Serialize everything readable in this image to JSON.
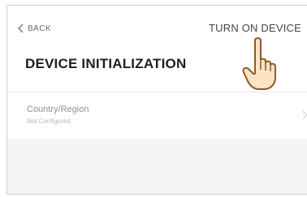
{
  "header": {
    "back_label": "BACK",
    "turn_on_label": "TURN ON DEVICE",
    "title": "DEVICE INITIALIZATION"
  },
  "settings": {
    "items": [
      {
        "label": "Country/Region",
        "value": "Not Configured"
      }
    ]
  },
  "icons": {
    "back": "chevron-left-icon",
    "row_arrow": "chevron-right-icon",
    "pointer": "hand-pointer-icon"
  },
  "colors": {
    "background": "#f5f5f5",
    "header": "#ffffff",
    "title_text": "#1f1f1f",
    "hand_fill": "#fbe3c4",
    "hand_stroke": "#8a5a2b"
  }
}
